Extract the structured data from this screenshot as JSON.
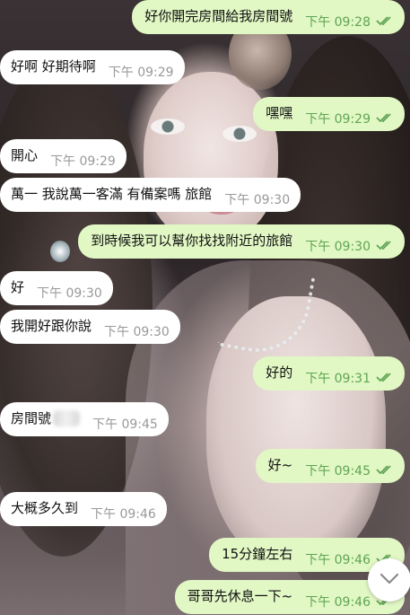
{
  "messages": [
    {
      "dir": "out",
      "text": "好你開完房間給我房間號",
      "time": "下午 09:28"
    },
    {
      "dir": "in",
      "text": "好啊 好期待啊",
      "time": "下午 09:29"
    },
    {
      "dir": "out",
      "text": "嘿嘿",
      "time": "下午 09:29"
    },
    {
      "dir": "in",
      "text": "開心",
      "time": "下午 09:29"
    },
    {
      "dir": "in",
      "text": "萬一 我說萬一客滿 有備案嗎 旅館",
      "time": "下午 09:30"
    },
    {
      "dir": "out",
      "text": "到時候我可以幫你找找附近的旅館",
      "time": "下午 09:30"
    },
    {
      "dir": "in",
      "text": "好",
      "time": "下午 09:30"
    },
    {
      "dir": "in",
      "text": "我開好跟你說",
      "time": "下午 09:30"
    },
    {
      "dir": "out",
      "text": "好的",
      "time": "下午 09:31"
    },
    {
      "dir": "in",
      "text": "房間號",
      "time": "下午 09:45"
    },
    {
      "dir": "out",
      "text": "好~",
      "time": "下午 09:45"
    },
    {
      "dir": "in",
      "text": "大概多久到",
      "time": "下午 09:46"
    },
    {
      "dir": "out",
      "text": "15分鐘左右",
      "time": "下午 09:46"
    },
    {
      "dir": "out",
      "text": "哥哥先休息一下~",
      "time": "下午 09:46"
    }
  ],
  "colors": {
    "outgoing_bubble": "#e1f7c4",
    "incoming_bubble": "#ffffff",
    "read_ticks": "#5fa554",
    "time_in": "#999999"
  },
  "icons": {
    "read": "double-check-icon",
    "scroll": "chevron-down-icon"
  }
}
